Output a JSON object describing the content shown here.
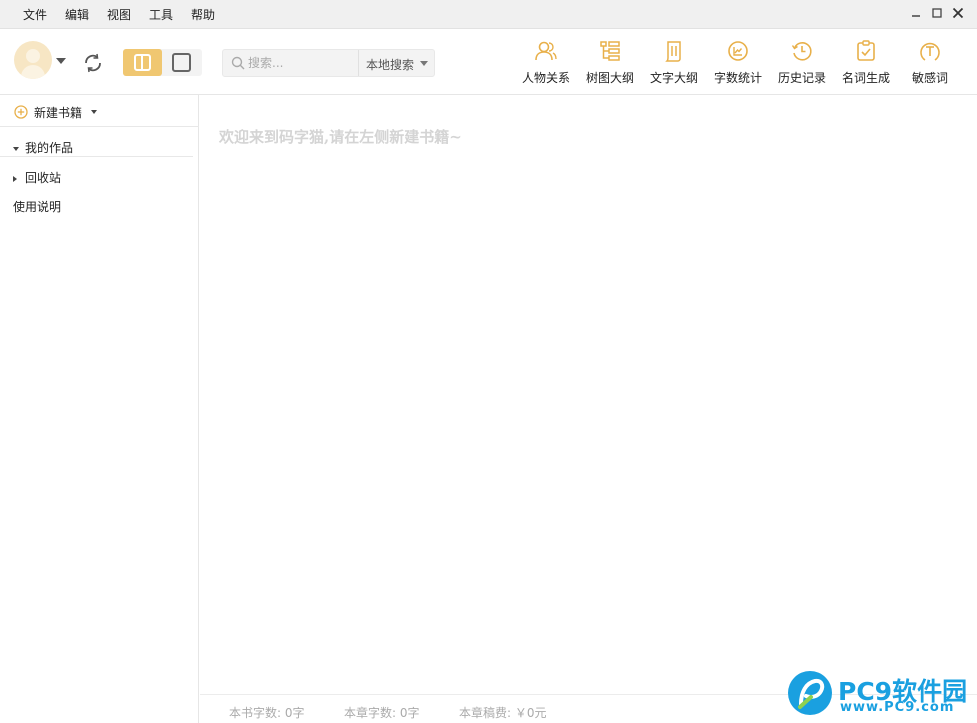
{
  "menu": {
    "items": [
      {
        "label": "文件"
      },
      {
        "label": "编辑"
      },
      {
        "label": "视图"
      },
      {
        "label": "工具"
      },
      {
        "label": "帮助"
      }
    ]
  },
  "window_controls": {
    "minimize": "minimize-icon",
    "maximize": "maximize-icon",
    "close": "close-icon"
  },
  "toolbar": {
    "search": {
      "placeholder": "搜索...",
      "scope": "本地搜索"
    },
    "tools": [
      {
        "label": "人物关系",
        "icon": "people-icon"
      },
      {
        "label": "树图大纲",
        "icon": "tree-outline-icon"
      },
      {
        "label": "文字大纲",
        "icon": "text-outline-icon"
      },
      {
        "label": "字数统计",
        "icon": "chart-icon"
      },
      {
        "label": "历史记录",
        "icon": "history-icon"
      },
      {
        "label": "名词生成",
        "icon": "generate-icon"
      },
      {
        "label": "敏感词",
        "icon": "sensitive-word-icon"
      }
    ]
  },
  "sidebar": {
    "new_book": "新建书籍",
    "items": [
      {
        "label": "我的作品",
        "expanded": true
      },
      {
        "label": "回收站",
        "expanded": false
      },
      {
        "label": "使用说明"
      }
    ]
  },
  "main": {
    "welcome": "欢迎来到码字猫,请在左侧新建书籍~"
  },
  "status": {
    "book_words": "本书字数:  0字",
    "chapter_words": "本章字数:  0字",
    "chapter_fee": "本章稿费:  ￥0元"
  },
  "watermark": {
    "title": "PC9软件园",
    "sub": "www.PC9.com"
  },
  "colors": {
    "accent": "#f0c771",
    "icon_gold": "#e8b04a",
    "watermark_blue": "#1aa0e0"
  }
}
